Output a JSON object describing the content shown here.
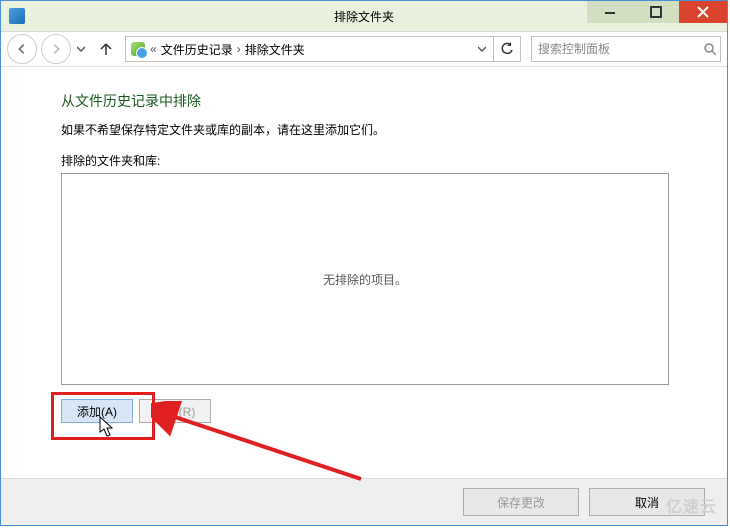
{
  "window": {
    "title": "排除文件夹"
  },
  "nav": {
    "breadcrumb_prefix": "«",
    "crumbs": [
      "文件历史记录",
      "排除文件夹"
    ],
    "search_placeholder": "搜索控制面板"
  },
  "main": {
    "heading": "从文件历史记录中排除",
    "subtext": "如果不希望保存特定文件夹或库的副本，请在这里添加它们。",
    "list_label": "排除的文件夹和库:",
    "empty_text": "无排除的项目。",
    "add_label": "添加(A)",
    "remove_label": "删除(R)"
  },
  "footer": {
    "save_label": "保存更改",
    "cancel_label": "取消"
  },
  "watermark": "亿速云"
}
